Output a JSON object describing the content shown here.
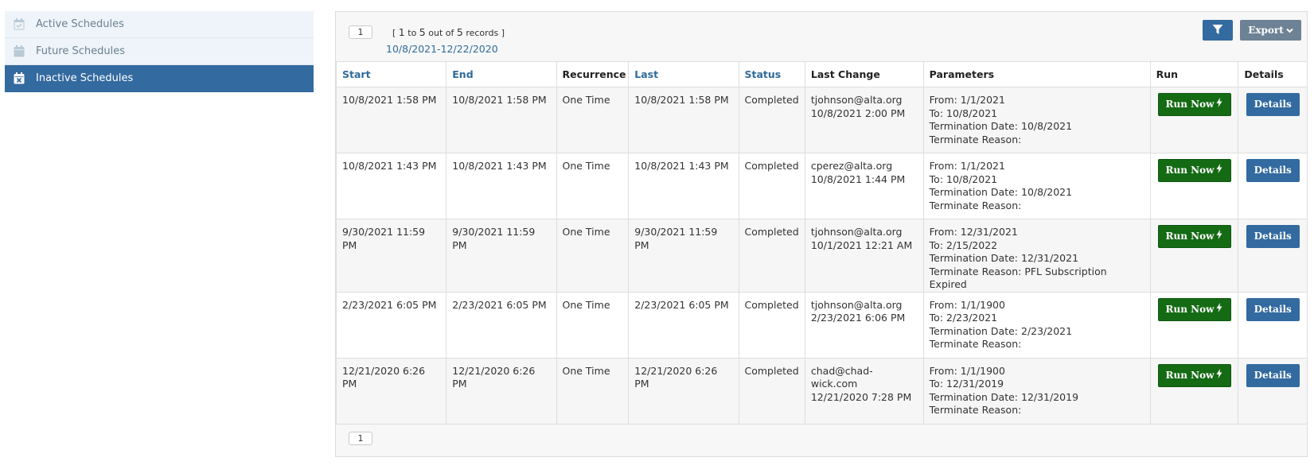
{
  "sidebar": {
    "items": [
      {
        "label": "Active Schedules",
        "active": false
      },
      {
        "label": "Future Schedules",
        "active": false
      },
      {
        "label": "Inactive Schedules",
        "active": true
      }
    ]
  },
  "toolbar": {
    "page": "1",
    "records_open": "[",
    "records_from": "1",
    "records_to_word": "to",
    "records_to": "5",
    "records_out_of_word": "out of",
    "records_total": "5",
    "records_word": "records",
    "records_close": "]",
    "date_range": "10/8/2021-12/22/2020",
    "filter_icon": "filter-icon",
    "export_label": "Export"
  },
  "table": {
    "columns": [
      "Start",
      "End",
      "Recurrence",
      "Last",
      "Status",
      "Last Change",
      "Parameters",
      "Run",
      "Details"
    ],
    "rows": [
      {
        "start": "10/8/2021 1:58 PM",
        "end": "10/8/2021 1:58 PM",
        "recurrence": "One Time",
        "last": "10/8/2021 1:58 PM",
        "status": "Completed",
        "change_user": "tjohnson@alta.org",
        "change_time": "10/8/2021 2:00 PM",
        "param_from": "From: 1/1/2021",
        "param_to": "To: 10/8/2021",
        "param_termination": "Termination Date: 10/8/2021",
        "param_reason": "Terminate Reason:",
        "run_label": "Run Now",
        "details_label": "Details"
      },
      {
        "start": "10/8/2021 1:43 PM",
        "end": "10/8/2021 1:43 PM",
        "recurrence": "One Time",
        "last": "10/8/2021 1:43 PM",
        "status": "Completed",
        "change_user": "cperez@alta.org",
        "change_time": "10/8/2021 1:44 PM",
        "param_from": "From: 1/1/2021",
        "param_to": "To: 10/8/2021",
        "param_termination": "Termination Date: 10/8/2021",
        "param_reason": "Terminate Reason:",
        "run_label": "Run Now",
        "details_label": "Details"
      },
      {
        "start": "9/30/2021 11:59 PM",
        "end": "9/30/2021 11:59 PM",
        "recurrence": "One Time",
        "last": "9/30/2021 11:59 PM",
        "status": "Completed",
        "change_user": "tjohnson@alta.org",
        "change_time": "10/1/2021 12:21 AM",
        "param_from": "From: 12/31/2021",
        "param_to": "To: 2/15/2022",
        "param_termination": "Termination Date: 12/31/2021",
        "param_reason": "Terminate Reason: PFL Subscription Expired",
        "run_label": "Run Now",
        "details_label": "Details"
      },
      {
        "start": "2/23/2021 6:05 PM",
        "end": "2/23/2021 6:05 PM",
        "recurrence": "One Time",
        "last": "2/23/2021 6:05 PM",
        "status": "Completed",
        "change_user": "tjohnson@alta.org",
        "change_time": "2/23/2021 6:06 PM",
        "param_from": "From: 1/1/1900",
        "param_to": "To: 2/23/2021",
        "param_termination": "Termination Date: 2/23/2021",
        "param_reason": "Terminate Reason:",
        "run_label": "Run Now",
        "details_label": "Details"
      },
      {
        "start": "12/21/2020 6:26 PM",
        "end": "12/21/2020 6:26 PM",
        "recurrence": "One Time",
        "last": "12/21/2020 6:26 PM",
        "status": "Completed",
        "change_user": "chad@chad-wick.com",
        "change_time": "12/21/2020 7:28 PM",
        "param_from": "From: 1/1/1900",
        "param_to": "To: 12/31/2019",
        "param_termination": "Termination Date: 12/31/2019",
        "param_reason": "Terminate Reason:",
        "run_label": "Run Now",
        "details_label": "Details"
      }
    ]
  },
  "footer": {
    "page": "1"
  },
  "colors": {
    "primary": "#336a9f",
    "run_green": "#146b14",
    "export_gray": "#6d8294",
    "link_blue": "#2f6b9b"
  }
}
